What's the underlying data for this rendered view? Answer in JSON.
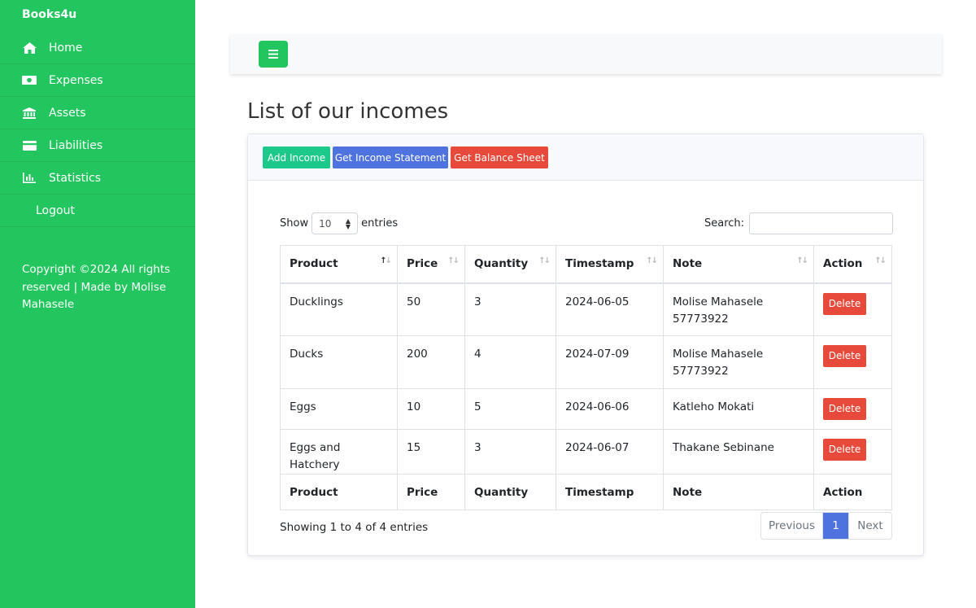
{
  "brand": "Books4u",
  "sidebar": {
    "items": [
      {
        "label": "Home",
        "icon": "home-icon"
      },
      {
        "label": "Expenses",
        "icon": "money-icon"
      },
      {
        "label": "Assets",
        "icon": "bank-icon"
      },
      {
        "label": "Liabilities",
        "icon": "credit-card-icon"
      },
      {
        "label": "Statistics",
        "icon": "bar-chart-icon"
      },
      {
        "label": "Logout",
        "icon": ""
      }
    ],
    "copyright": "Copyright ©2024 All rights reserved | Made by Molise Mahasele"
  },
  "page": {
    "title": "List of our incomes"
  },
  "toolbar": {
    "add_label": "Add Income",
    "income_label": "Get Income Statement",
    "balance_label": "Get Balance Sheet"
  },
  "controls": {
    "show_label": "Show",
    "entries_label": "entries",
    "page_size": "10",
    "search_label": "Search:",
    "search_value": ""
  },
  "table": {
    "columns": [
      "Product",
      "Price",
      "Quantity",
      "Timestamp",
      "Note",
      "Action"
    ],
    "rows": [
      {
        "product": "Ducklings",
        "price": "50",
        "quantity": "3",
        "timestamp": "2024-06-05",
        "note": "Molise Mahasele 57773922",
        "action": "Delete"
      },
      {
        "product": "Ducks",
        "price": "200",
        "quantity": "4",
        "timestamp": "2024-07-09",
        "note": "Molise Mahasele 57773922",
        "action": "Delete"
      },
      {
        "product": "Eggs",
        "price": "10",
        "quantity": "5",
        "timestamp": "2024-06-06",
        "note": "Katleho Mokati",
        "action": "Delete"
      },
      {
        "product": "Eggs and Hatchery",
        "price": "15",
        "quantity": "3",
        "timestamp": "2024-06-07",
        "note": "Thakane Sebinane",
        "action": "Delete"
      }
    ]
  },
  "footer": {
    "info": "Showing 1 to 4 of 4 entries",
    "prev": "Previous",
    "current_page": "1",
    "next": "Next"
  },
  "colors": {
    "sidebar": "#22c55e",
    "primary": "#4e73df",
    "success": "#1cc88a",
    "danger": "#e74a3b"
  }
}
